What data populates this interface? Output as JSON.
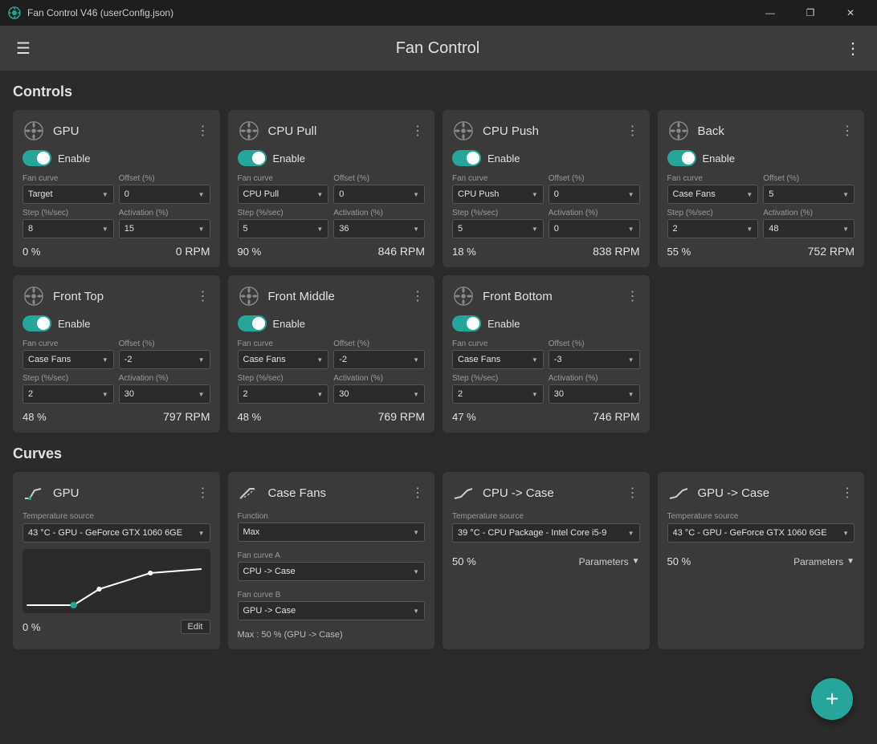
{
  "titlebar": {
    "title": "Fan Control V46 (userConfig.json)",
    "min": "—",
    "max": "❐",
    "close": "✕"
  },
  "header": {
    "title": "Fan Control",
    "hamburger": "☰",
    "dots": "⋮"
  },
  "sections": {
    "controls_label": "Controls",
    "curves_label": "Curves"
  },
  "controls": [
    {
      "title": "GPU",
      "enabled": true,
      "fan_curve_label": "Fan curve",
      "fan_curve_value": "Target",
      "offset_label": "Offset (%)",
      "offset_value": "0",
      "step_label": "Step (%/sec)",
      "step_value": "8",
      "activation_label": "Activation (%)",
      "activation_value": "15",
      "percent": "0 %",
      "rpm": "0 RPM"
    },
    {
      "title": "CPU Pull",
      "enabled": true,
      "fan_curve_label": "Fan curve",
      "fan_curve_value": "CPU Pull",
      "offset_label": "Offset (%)",
      "offset_value": "0",
      "step_label": "Step (%/sec)",
      "step_value": "5",
      "activation_label": "Activation (%)",
      "activation_value": "36",
      "percent": "90 %",
      "rpm": "846 RPM"
    },
    {
      "title": "CPU Push",
      "enabled": true,
      "fan_curve_label": "Fan curve",
      "fan_curve_value": "CPU Push",
      "offset_label": "Offset (%)",
      "offset_value": "0",
      "step_label": "Step (%/sec)",
      "step_value": "5",
      "activation_label": "Activation (%)",
      "activation_value": "0",
      "percent": "18 %",
      "rpm": "838 RPM"
    },
    {
      "title": "Back",
      "enabled": true,
      "fan_curve_label": "Fan curve",
      "fan_curve_value": "Case Fans",
      "offset_label": "Offset (%)",
      "offset_value": "5",
      "step_label": "Step (%/sec)",
      "step_value": "2",
      "activation_label": "Activation (%)",
      "activation_value": "48",
      "percent": "55 %",
      "rpm": "752 RPM"
    },
    {
      "title": "Front Top",
      "enabled": true,
      "fan_curve_label": "Fan curve",
      "fan_curve_value": "Case Fans",
      "offset_label": "Offset (%)",
      "offset_value": "-2",
      "step_label": "Step (%/sec)",
      "step_value": "2",
      "activation_label": "Activation (%)",
      "activation_value": "30",
      "percent": "48 %",
      "rpm": "797 RPM"
    },
    {
      "title": "Front Middle",
      "enabled": true,
      "fan_curve_label": "Fan curve",
      "fan_curve_value": "Case Fans",
      "offset_label": "Offset (%)",
      "offset_value": "-2",
      "step_label": "Step (%/sec)",
      "step_value": "2",
      "activation_label": "Activation (%)",
      "activation_value": "30",
      "percent": "48 %",
      "rpm": "769 RPM"
    },
    {
      "title": "Front Bottom",
      "enabled": true,
      "fan_curve_label": "Fan curve",
      "fan_curve_value": "Case Fans",
      "offset_label": "Offset (%)",
      "offset_value": "-3",
      "step_label": "Step (%/sec)",
      "step_value": "2",
      "activation_label": "Activation (%)",
      "activation_value": "30",
      "percent": "47 %",
      "rpm": "746 RPM"
    }
  ],
  "curves": [
    {
      "title": "GPU",
      "icon_type": "linear",
      "temp_source_label": "Temperature source",
      "temp_source_value": "43 °C - GPU - GeForce GTX 1060 6GE",
      "percent": "0 %",
      "edit_label": "Edit",
      "has_chart": true
    },
    {
      "title": "Case Fans",
      "icon_type": "max",
      "function_label": "Function",
      "function_value": "Max",
      "fan_curve_a_label": "Fan curve A",
      "fan_curve_a_value": "CPU -> Case",
      "fan_curve_b_label": "Fan curve B",
      "fan_curve_b_value": "GPU -> Case",
      "max_info": "Max : 50 % (GPU -> Case)",
      "has_chart": false
    },
    {
      "title": "CPU -> Case",
      "icon_type": "linear2",
      "temp_source_label": "Temperature source",
      "temp_source_value": "39 °C - CPU Package - Intel Core i5-9",
      "percent": "50 %",
      "params_label": "Parameters",
      "has_chart": false
    },
    {
      "title": "GPU -> Case",
      "icon_type": "linear2",
      "temp_source_label": "Temperature source",
      "temp_source_value": "43 °C - GPU - GeForce GTX 1060 6GE",
      "percent": "50 %",
      "params_label": "Parameters",
      "has_chart": false
    }
  ],
  "fab": {
    "label": "+"
  }
}
